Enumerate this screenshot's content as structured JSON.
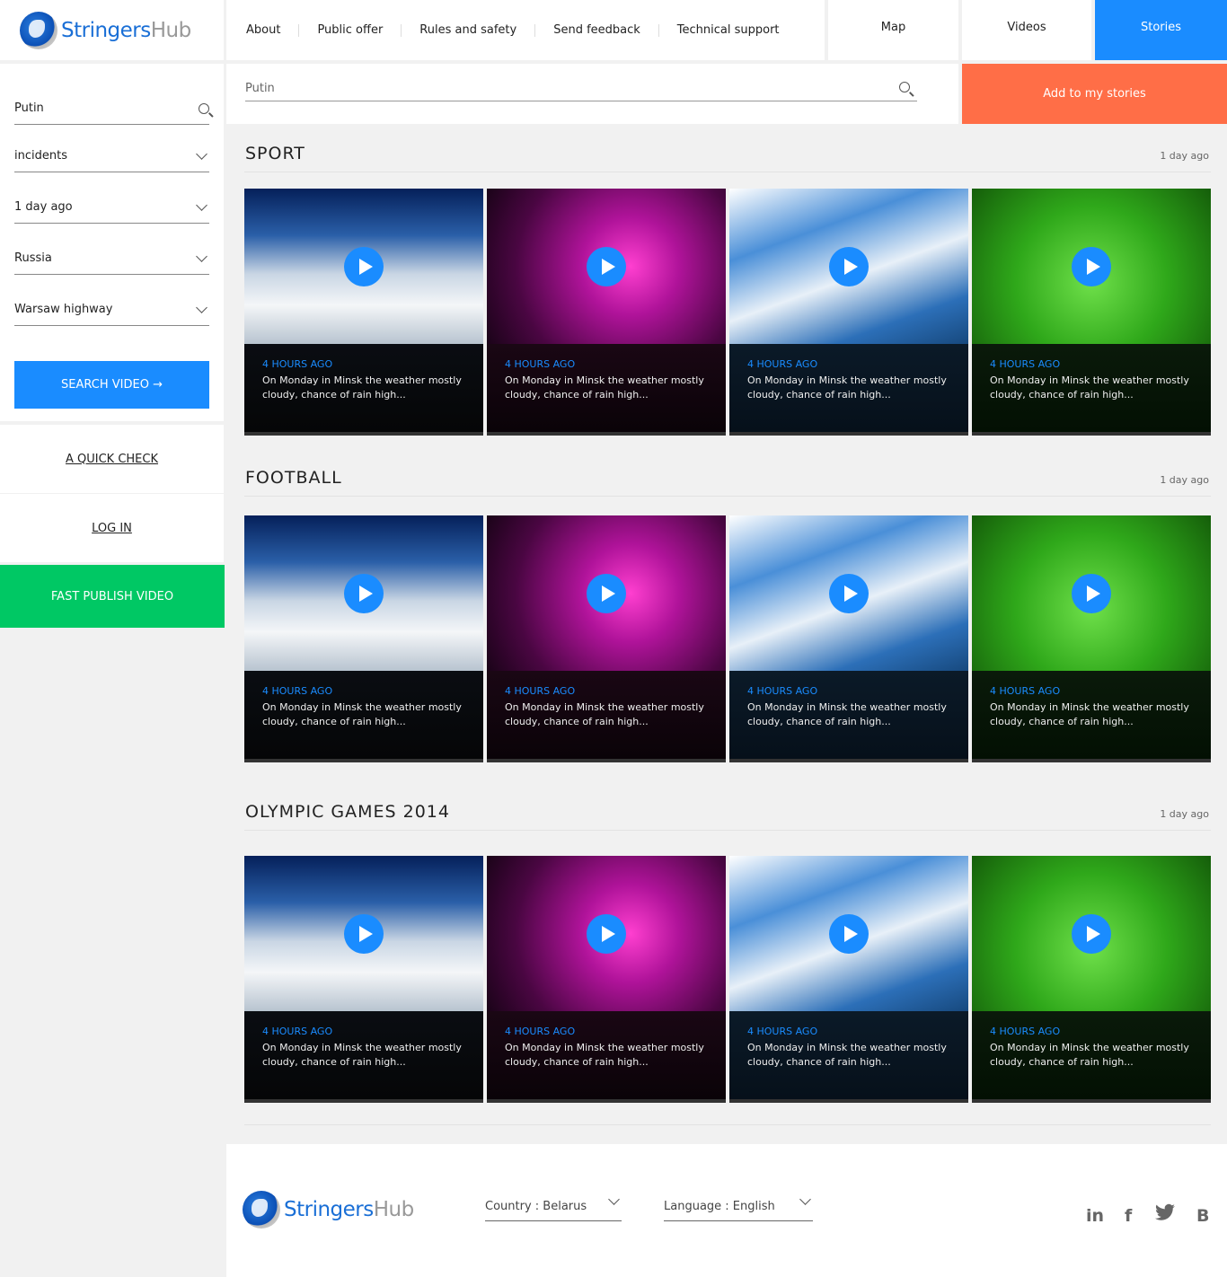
{
  "brand": {
    "name_a": "Stringers",
    "name_b": "Hub"
  },
  "nav": [
    "About",
    "Public offer",
    "Rules and safety",
    "Send feedback",
    "Technical support"
  ],
  "tabs": {
    "map": "Map",
    "videos": "Videos",
    "stories": "Stories"
  },
  "colors": {
    "accent": "#1a8cff",
    "orange": "#ff6e47",
    "green": "#00c864"
  },
  "sidebar": {
    "search_value": "Putin",
    "filters": [
      "incidents",
      "1 day ago",
      "Russia",
      "Warsaw highway"
    ],
    "search_button": "SEARCH VIDEO →",
    "quick_check": "A QUICK CHECK",
    "login": "LOG IN",
    "fast_publish": "FAST PUBLISH VIDEO"
  },
  "search": {
    "value": "Putin",
    "add_button": "Add to my stories"
  },
  "sections": [
    {
      "title": "SPORT",
      "date": "1 day ago"
    },
    {
      "title": "FOOTBALL",
      "date": "1 day ago"
    },
    {
      "title": "OLYMPIC GAMES 2014",
      "date": "1 day ago"
    }
  ],
  "card": {
    "ago": "4 HOURS AGO",
    "desc": "On Monday in Minsk the weather mostly cloudy, chance of rain high..."
  },
  "footer": {
    "country": "Country : Belarus",
    "language": "Language : English",
    "social": [
      "in",
      "f",
      "B"
    ]
  }
}
